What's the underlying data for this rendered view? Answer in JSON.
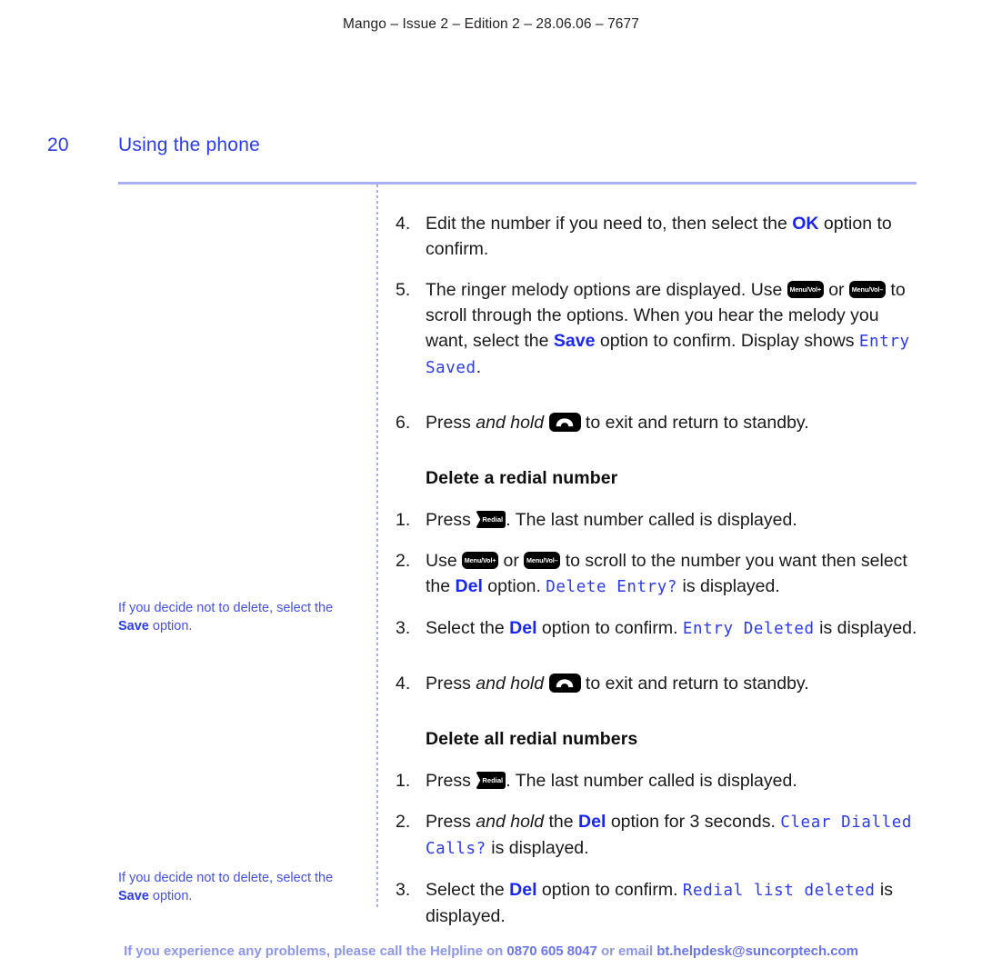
{
  "header": {
    "running_head": "Mango – Issue 2 – Edition 2 – 28.06.06 – 7677"
  },
  "page": {
    "folio": "20",
    "chapter_title": "Using the phone"
  },
  "colors": {
    "accent_blue": "#2b3bf0",
    "option_blue": "#1826f2",
    "rule_blue": "#a9b0f2",
    "footer_blue": "#8e96ee",
    "key_black": "#000000"
  },
  "icons": {
    "menu_vol_up": "Menu/Vol+",
    "menu_vol_down": "Menu/Vol–",
    "redial": "Redial",
    "phone_handset": "phone-handset-icon"
  },
  "margin_notes": [
    {
      "text_before": "If you decide not to delete, select the ",
      "bold": "Save",
      "text_after": " option."
    },
    {
      "text_before": "If you decide not to delete, select the ",
      "bold": "Save",
      "text_after": " option."
    }
  ],
  "main": {
    "steps_continued": [
      {
        "num": "4.",
        "p1": "Edit the number if you need to, then select the ",
        "opt1": "OK",
        "p2": " option to confirm."
      },
      {
        "num": "5.",
        "p1": "The ringer melody options are displayed. Use ",
        "p2": " or ",
        "p3": " to scroll through the options. When you hear the melody you want, select the ",
        "opt1": "Save",
        "p4": " option to confirm. Display shows ",
        "lcd1": "Entry Saved",
        "p5": "."
      },
      {
        "num": "6.",
        "p1": "Press ",
        "ital": "and hold",
        "p2": " ",
        "p3": " to exit and return to standby."
      }
    ],
    "section_delete_one": {
      "heading": "Delete a redial number",
      "steps": [
        {
          "num": "1.",
          "p1": "Press ",
          "p2": ". The last number called is displayed."
        },
        {
          "num": "2.",
          "p1": "Use ",
          "p2": " or ",
          "p3": " to scroll to the number you want then select the ",
          "opt1": "Del",
          "p4": " option. ",
          "lcd1": "Delete Entry?",
          "p5": " is displayed."
        },
        {
          "num": "3.",
          "p1": "Select the ",
          "opt1": "Del",
          "p2": " option to confirm. ",
          "lcd1": "Entry Deleted",
          "p3": " is displayed."
        },
        {
          "num": "4.",
          "p1": "Press ",
          "ital": "and hold",
          "p2": " ",
          "p3": " to exit and return to standby."
        }
      ]
    },
    "section_delete_all": {
      "heading": "Delete all redial numbers",
      "steps": [
        {
          "num": "1.",
          "p1": "Press ",
          "p2": ". The last number called is displayed."
        },
        {
          "num": "2.",
          "p1": "Press ",
          "ital": "and hold",
          "p2": " the ",
          "opt1": "Del",
          "p3": " option for 3 seconds. ",
          "lcd1": "Clear Dialled Calls?",
          "p4": " is displayed."
        },
        {
          "num": "3.",
          "p1": "Select the ",
          "opt1": "Del",
          "p2": " option to confirm. ",
          "lcd1": "Redial list deleted",
          "p3": " is displayed."
        }
      ]
    }
  },
  "footer": {
    "part1": "If you experience any problems, please call the Helpline on ",
    "phone": "0870 605 8047",
    "part2": " or email ",
    "email": "bt.helpdesk@suncorptech.com"
  }
}
